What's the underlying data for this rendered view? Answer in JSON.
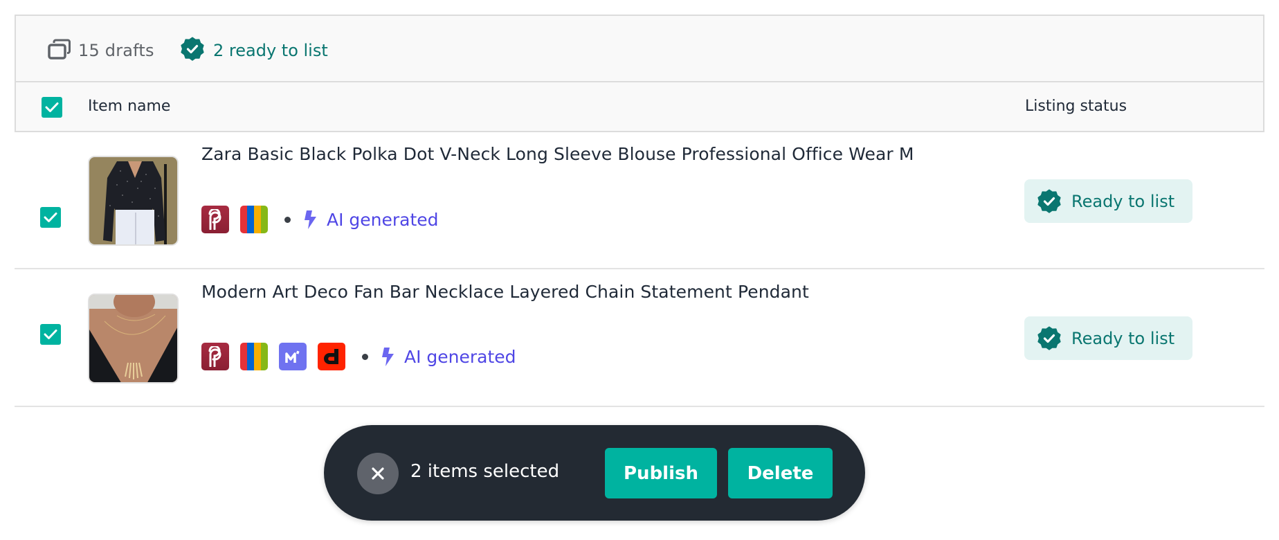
{
  "summary": {
    "drafts_label": "15 drafts",
    "ready_label": "2 ready to list"
  },
  "columns": {
    "item_name": "Item name",
    "listing_status": "Listing status"
  },
  "colors": {
    "accent": "#00b3a0",
    "ready_text": "#0a7670",
    "ready_bg": "#e3f3f2",
    "ai_text": "#4f46e5",
    "action_bar_bg": "#232a33"
  },
  "items": [
    {
      "title": "Zara Basic Black Polka Dot V-Neck Long Sleeve Blouse Professional Office Wear M",
      "thumbnail": "black-polka-dot-blouse-photo",
      "selected": true,
      "platforms": [
        "poshmark-icon",
        "ebay-icon"
      ],
      "ai_label": "AI generated",
      "status": "Ready to list"
    },
    {
      "title": "Modern Art Deco Fan Bar Necklace Layered Chain Statement Pendant",
      "thumbnail": "gold-fan-necklace-photo",
      "selected": true,
      "platforms": [
        "poshmark-icon",
        "ebay-icon",
        "mercari-icon",
        "depop-icon"
      ],
      "ai_label": "AI generated",
      "status": "Ready to list"
    }
  ],
  "action_bar": {
    "selected_text": "2 items selected",
    "publish_label": "Publish",
    "delete_label": "Delete"
  }
}
